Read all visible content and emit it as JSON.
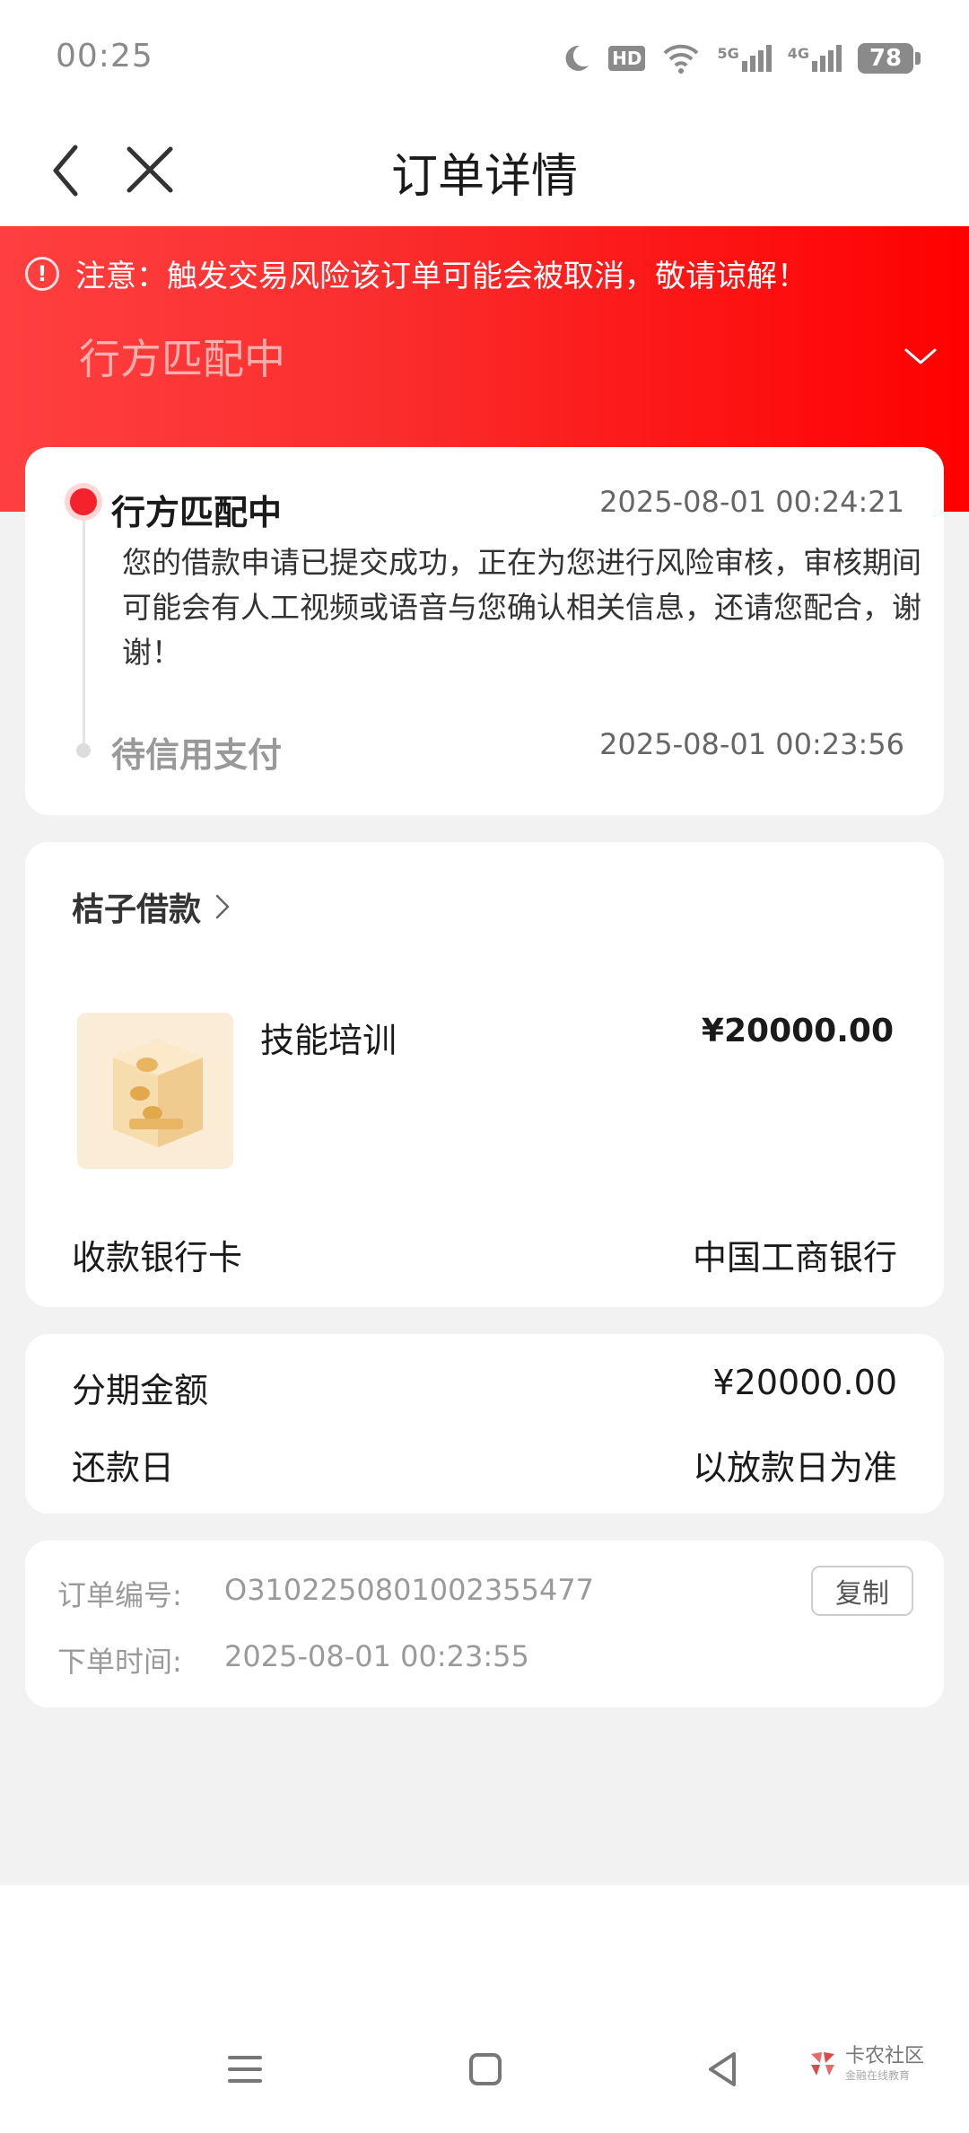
{
  "status_bar": {
    "time": "00:25",
    "battery": "78",
    "icons": [
      "moon-icon",
      "hd-icon",
      "wifi-icon",
      "5g-signal-icon",
      "4g-signal-icon",
      "battery-icon"
    ],
    "hd_label": "HD",
    "net1": "5G",
    "net2": "4G"
  },
  "nav": {
    "title": "订单详情"
  },
  "hero": {
    "notice": "注意：触发交易风险该订单可能会被取消，敬请谅解！",
    "status": "行方匹配中",
    "accent": "#ff0000"
  },
  "timeline": [
    {
      "title": "行方匹配中",
      "time": "2025-08-01 00:24:21",
      "desc": "您的借款申请已提交成功，正在为您进行风险审核，审核期间可能会有人工视频或语音与您确认相关信息，还请您配合，谢谢！"
    },
    {
      "title": "待信用支付",
      "time": "2025-08-01 00:23:56"
    }
  ],
  "order": {
    "merchant": "桔子借款",
    "product_name": "技能培训",
    "product_price": "¥20000.00",
    "bank_label": "收款银行卡",
    "bank_value": "中国工商银行"
  },
  "installment": {
    "amount_label": "分期金额",
    "amount_value": "¥20000.00",
    "repay_label": "还款日",
    "repay_value": "以放款日为准"
  },
  "meta": {
    "order_no_label": "订单编号:",
    "order_no_value": "O3102250801002355477",
    "order_time_label": "下单时间:",
    "order_time_value": "2025-08-01 00:23:55",
    "copy_label": "复制"
  },
  "watermark": {
    "title": "卡农社区",
    "sub": "金融在线教育"
  }
}
